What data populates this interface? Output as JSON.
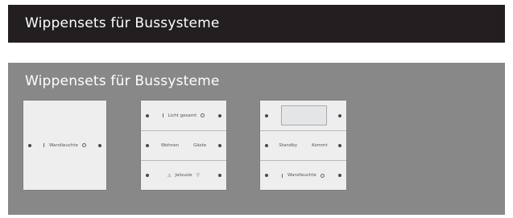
{
  "header": {
    "title": "Wippensets für Bussysteme"
  },
  "panel": {
    "title": "Wippensets für Bussysteme",
    "switch1": {
      "rocker": "Wandleuchte"
    },
    "switch2": {
      "rocker_top": "Licht gesamt",
      "rocker_mid_left": "Wohnen",
      "rocker_mid_right": "Gäste",
      "rocker_bottom": "Jalousie"
    },
    "switch3": {
      "rocker_mid_left": "Standby",
      "rocker_mid_right": "Kommt",
      "rocker_bottom": "Wandleuchte"
    }
  },
  "colors": {
    "header_bg": "#231f20",
    "panel_bg": "#888889",
    "switch_face": "#eeeeef"
  },
  "icons": [
    "led-icon",
    "ring-icon",
    "bar-icon",
    "triangle-up-icon",
    "triangle-down-icon"
  ]
}
